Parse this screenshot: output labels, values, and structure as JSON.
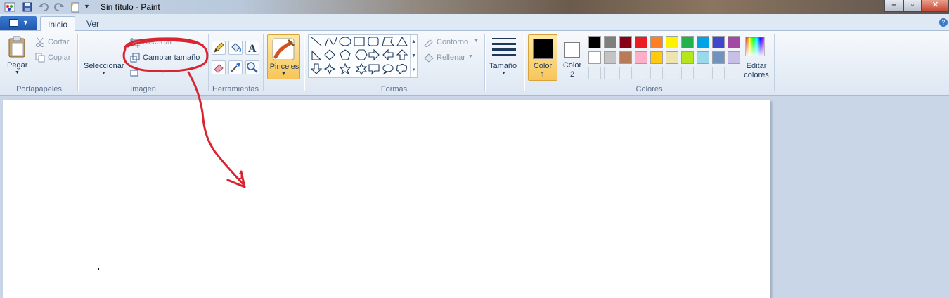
{
  "window": {
    "title": "Sin título - Paint"
  },
  "tabs": [
    {
      "label": "Inicio",
      "active": true
    },
    {
      "label": "Ver",
      "active": false
    }
  ],
  "groups": {
    "clipboard": {
      "label": "Portapapeles",
      "paste": "Pegar",
      "cut": "Cortar",
      "copy": "Copiar"
    },
    "image": {
      "label": "Imagen",
      "select": "Seleccionar",
      "crop": "Recortar",
      "resize": "Cambiar tamaño"
    },
    "tools": {
      "label": "Herramientas",
      "items": [
        "pencil-icon",
        "fill-icon",
        "text-icon",
        "eraser-icon",
        "color-picker-icon",
        "magnifier-icon"
      ]
    },
    "brushes": {
      "label": "Pinceles"
    },
    "shapes": {
      "label": "Formas",
      "outline": "Contorno",
      "fill": "Rellenar"
    },
    "size": {
      "label": "Tamaño"
    },
    "colors": {
      "label": "Colores",
      "color1": "Color\n1",
      "color1_line1": "Color",
      "color1_line2": "1",
      "color2_line1": "Color",
      "color2_line2": "2",
      "edit_line1": "Editar",
      "edit_line2": "colores",
      "color1_value": "#000000",
      "color2_value": "#ffffff",
      "row1": [
        "#000000",
        "#7f7f7f",
        "#880015",
        "#ed1c24",
        "#ff7f27",
        "#fff200",
        "#22b14c",
        "#00a2e8",
        "#3f48cc",
        "#a349a4"
      ],
      "row2": [
        "#ffffff",
        "#c3c3c3",
        "#b97a57",
        "#ffaec9",
        "#ffc90e",
        "#efe4b0",
        "#b5e61d",
        "#99d9ea",
        "#7092be",
        "#c8bfe7"
      ]
    }
  },
  "annotation": {
    "mark": "1",
    "color": "#d9252f"
  }
}
